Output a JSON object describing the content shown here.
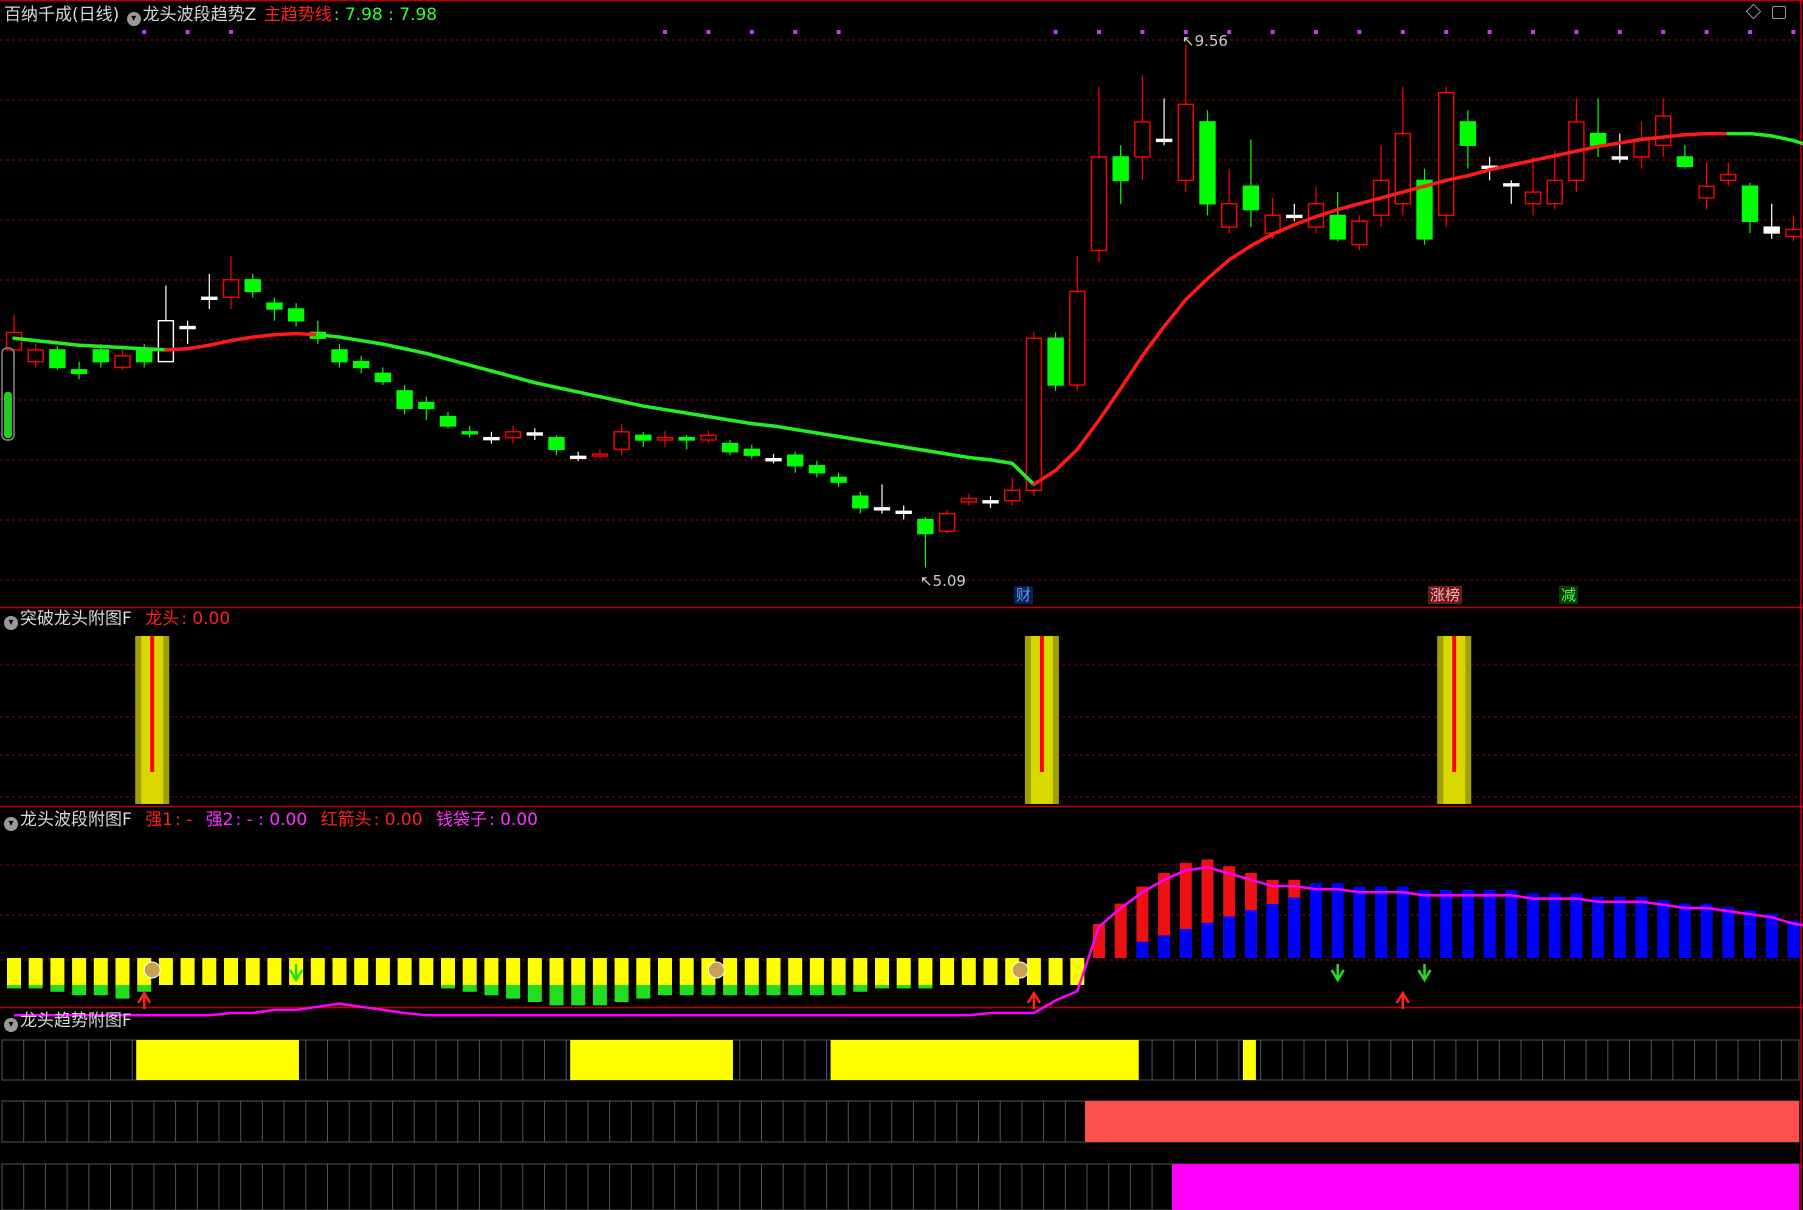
{
  "header": {
    "stock_name": "百纳千成(日线)",
    "indicator": "龙头波段趋势Z",
    "trend_label": "主趋势线",
    "trend_values": ": 7.98 : 7.98"
  },
  "main_chart": {
    "high_marker": "9.56",
    "low_marker": "5.09",
    "events": [
      {
        "label": "财",
        "color": "#5aa0ff",
        "bg": "#0a2050"
      },
      {
        "label": "涨榜",
        "color": "#ffb0b0",
        "bg": "#6a1a1a"
      },
      {
        "label": "减",
        "color": "#4dff4d",
        "bg": "#0a3a0a"
      }
    ]
  },
  "panel_breakout": {
    "title": "突破龙头附图F",
    "metric_label": "龙头",
    "metric_value": ": 0.00"
  },
  "panel_wave": {
    "title": "龙头波段附图F",
    "strong1_label": "强1",
    "strong1_value": ": -",
    "strong2_label": "强2",
    "strong2_value": ": - : 0.00",
    "red_arrow_label": "红箭头",
    "red_arrow_value": ": 0.00",
    "money_bag_label": "钱袋子",
    "money_bag_value": ": 0.00"
  },
  "panel_trend": {
    "title": "龙头趋势附图F"
  },
  "colors": {
    "up": "#ff0000",
    "down": "#00ff00",
    "neutral": "#ffffff",
    "yellow": "#ffff00",
    "blue": "#0000ff",
    "magenta": "#ff00ff",
    "salmon": "#ff4f4f",
    "grid": "#8a0000"
  },
  "icons": {
    "panel_toggle": "chevron-down-icon",
    "top_right_a": "diamond-icon",
    "top_right_b": "maximize-icon"
  },
  "chart_data": [
    {
      "type": "candlestick",
      "title": "龙头波段趋势Z",
      "ohlc": [
        [
          6.95,
          7.1,
          6.8,
          7.25
        ],
        [
          6.85,
          6.95,
          6.8,
          7.0
        ],
        [
          6.95,
          6.8,
          6.78,
          6.98
        ],
        [
          6.78,
          6.75,
          6.7,
          6.85
        ],
        [
          6.95,
          6.85,
          6.8,
          7.0
        ],
        [
          6.8,
          6.9,
          6.78,
          6.95
        ],
        [
          6.95,
          6.85,
          6.8,
          7.0
        ],
        [
          6.85,
          7.2,
          6.85,
          7.5
        ],
        [
          7.15,
          7.15,
          7.0,
          7.2
        ],
        [
          7.4,
          7.4,
          7.3,
          7.6
        ],
        [
          7.4,
          7.55,
          7.3,
          7.75
        ],
        [
          7.55,
          7.45,
          7.4,
          7.6
        ],
        [
          7.35,
          7.3,
          7.2,
          7.4
        ],
        [
          7.3,
          7.2,
          7.15,
          7.35
        ],
        [
          7.1,
          7.05,
          7.0,
          7.2
        ],
        [
          6.95,
          6.85,
          6.8,
          7.0
        ],
        [
          6.85,
          6.8,
          6.75,
          6.9
        ],
        [
          6.75,
          6.68,
          6.65,
          6.8
        ],
        [
          6.6,
          6.45,
          6.4,
          6.65
        ],
        [
          6.5,
          6.45,
          6.35,
          6.55
        ],
        [
          6.38,
          6.3,
          6.28,
          6.42
        ],
        [
          6.25,
          6.24,
          6.2,
          6.3
        ],
        [
          6.2,
          6.2,
          6.15,
          6.25
        ],
        [
          6.2,
          6.25,
          6.15,
          6.3
        ],
        [
          6.24,
          6.24,
          6.18,
          6.28
        ],
        [
          6.2,
          6.1,
          6.05,
          6.22
        ],
        [
          6.04,
          6.04,
          6.0,
          6.08
        ],
        [
          6.05,
          6.06,
          6.02,
          6.1
        ],
        [
          6.1,
          6.25,
          6.05,
          6.32
        ],
        [
          6.22,
          6.18,
          6.12,
          6.25
        ],
        [
          6.18,
          6.2,
          6.12,
          6.26
        ],
        [
          6.2,
          6.18,
          6.1,
          6.22
        ],
        [
          6.18,
          6.22,
          6.15,
          6.26
        ],
        [
          6.15,
          6.08,
          6.05,
          6.18
        ],
        [
          6.1,
          6.05,
          6.02,
          6.14
        ],
        [
          6.02,
          6.02,
          5.98,
          6.06
        ],
        [
          6.05,
          5.96,
          5.9,
          6.08
        ],
        [
          5.96,
          5.9,
          5.86,
          6.0
        ],
        [
          5.86,
          5.82,
          5.78,
          5.9
        ],
        [
          5.7,
          5.6,
          5.55,
          5.74
        ],
        [
          5.6,
          5.6,
          5.55,
          5.8
        ],
        [
          5.57,
          5.57,
          5.5,
          5.62
        ],
        [
          5.5,
          5.38,
          5.09,
          5.52
        ],
        [
          5.4,
          5.55,
          5.38,
          5.58
        ],
        [
          5.65,
          5.68,
          5.62,
          5.72
        ],
        [
          5.66,
          5.66,
          5.6,
          5.7
        ],
        [
          5.66,
          5.75,
          5.62,
          5.86
        ],
        [
          5.75,
          7.05,
          5.7,
          7.1
        ],
        [
          7.05,
          6.65,
          6.6,
          7.1
        ],
        [
          6.65,
          7.45,
          6.6,
          7.75
        ],
        [
          7.8,
          8.6,
          7.7,
          9.2
        ],
        [
          8.6,
          8.4,
          8.2,
          8.7
        ],
        [
          8.6,
          8.9,
          8.4,
          9.3
        ],
        [
          8.75,
          8.75,
          8.7,
          9.1
        ],
        [
          8.4,
          9.05,
          8.3,
          9.56
        ],
        [
          8.9,
          8.2,
          8.1,
          9.0
        ],
        [
          8.0,
          8.2,
          7.95,
          8.5
        ],
        [
          8.35,
          8.15,
          8.0,
          8.75
        ],
        [
          7.95,
          8.1,
          7.9,
          8.25
        ],
        [
          8.1,
          8.1,
          8.05,
          8.2
        ],
        [
          8.0,
          8.2,
          7.95,
          8.35
        ],
        [
          8.1,
          7.9,
          7.88,
          8.3
        ],
        [
          7.85,
          8.05,
          7.8,
          8.1
        ],
        [
          8.1,
          8.4,
          8.0,
          8.7
        ],
        [
          8.2,
          8.8,
          8.1,
          9.2
        ],
        [
          8.4,
          7.9,
          7.85,
          8.5
        ],
        [
          8.1,
          9.15,
          8.0,
          9.2
        ],
        [
          8.9,
          8.7,
          8.5,
          9.0
        ],
        [
          8.52,
          8.52,
          8.4,
          8.6
        ],
        [
          8.37,
          8.37,
          8.2,
          8.4
        ],
        [
          8.2,
          8.3,
          8.1,
          8.6
        ],
        [
          8.2,
          8.4,
          8.15,
          8.65
        ],
        [
          8.4,
          8.9,
          8.3,
          9.1
        ],
        [
          8.8,
          8.7,
          8.6,
          9.1
        ],
        [
          8.6,
          8.6,
          8.55,
          8.8
        ],
        [
          8.6,
          8.75,
          8.5,
          8.9
        ],
        [
          8.7,
          8.95,
          8.6,
          9.1
        ],
        [
          8.6,
          8.52,
          8.5,
          8.7
        ],
        [
          8.25,
          8.35,
          8.15,
          8.55
        ],
        [
          8.4,
          8.45,
          8.35,
          8.55
        ],
        [
          8.35,
          8.05,
          7.95,
          8.38
        ],
        [
          8.0,
          7.95,
          7.9,
          8.2
        ],
        [
          7.92,
          7.98,
          7.88,
          8.1
        ],
        [
          7.95,
          7.7,
          7.6,
          8.05
        ]
      ],
      "trend_line": [
        7.05,
        7.03,
        7.01,
        6.99,
        6.98,
        6.97,
        6.96,
        6.95,
        6.96,
        6.99,
        7.03,
        7.06,
        7.08,
        7.09,
        7.08,
        7.06,
        7.03,
        7.0,
        6.96,
        6.92,
        6.87,
        6.82,
        6.77,
        6.72,
        6.67,
        6.63,
        6.59,
        6.55,
        6.51,
        6.47,
        6.44,
        6.41,
        6.38,
        6.35,
        6.32,
        6.3,
        6.27,
        6.24,
        6.21,
        6.18,
        6.15,
        6.12,
        6.09,
        6.06,
        6.03,
        6.01,
        5.98,
        5.8,
        5.92,
        6.1,
        6.35,
        6.62,
        6.9,
        7.15,
        7.38,
        7.56,
        7.72,
        7.84,
        7.94,
        8.02,
        8.09,
        8.15,
        8.2,
        8.25,
        8.3,
        8.35,
        8.4,
        8.44,
        8.49,
        8.53,
        8.57,
        8.61,
        8.65,
        8.69,
        8.72,
        8.75,
        8.77,
        8.79,
        8.8,
        8.8,
        8.8,
        8.78,
        8.74,
        8.68
      ],
      "trend_up_from": 7,
      "trend_up_to": 14,
      "trend_up2_from": 47,
      "trend_up2_to": 79,
      "high": 9.56,
      "low": 5.09
    },
    {
      "type": "bar",
      "title": "突破龙头附图F",
      "series": [
        {
          "name": "龙头",
          "signal_bars": [
            6,
            47,
            66
          ]
        }
      ]
    },
    {
      "type": "bar",
      "title": "龙头波段附图F",
      "values": [
        -1.0,
        -1.0,
        -1.1,
        -1.2,
        -1.2,
        -1.3,
        -1.1,
        -0.9,
        -0.9,
        -0.9,
        -0.8,
        -0.8,
        -0.7,
        -0.7,
        -0.6,
        -0.5,
        -0.6,
        -0.7,
        -0.8,
        -0.9,
        -1.0,
        -1.1,
        -1.2,
        -1.3,
        -1.4,
        -1.5,
        -1.5,
        -1.5,
        -1.4,
        -1.3,
        -1.2,
        -1.2,
        -1.2,
        -1.2,
        -1.2,
        -1.2,
        -1.2,
        -1.2,
        -1.2,
        -1.1,
        -1.0,
        -1.0,
        -1.0,
        -0.9,
        -0.9,
        -0.8,
        -0.8,
        -0.8,
        -0.4,
        -0.1,
        1.0,
        1.6,
        2.1,
        2.5,
        2.8,
        2.9,
        2.7,
        2.5,
        2.3,
        2.3,
        2.2,
        2.2,
        2.1,
        2.1,
        2.1,
        2.0,
        2.0,
        2.0,
        2.0,
        2.0,
        1.9,
        1.9,
        1.9,
        1.8,
        1.8,
        1.8,
        1.7,
        1.6,
        1.6,
        1.5,
        1.4,
        1.3,
        1.1,
        1.0
      ],
      "ylim": [
        -1.6,
        3.2
      ]
    }
  ]
}
